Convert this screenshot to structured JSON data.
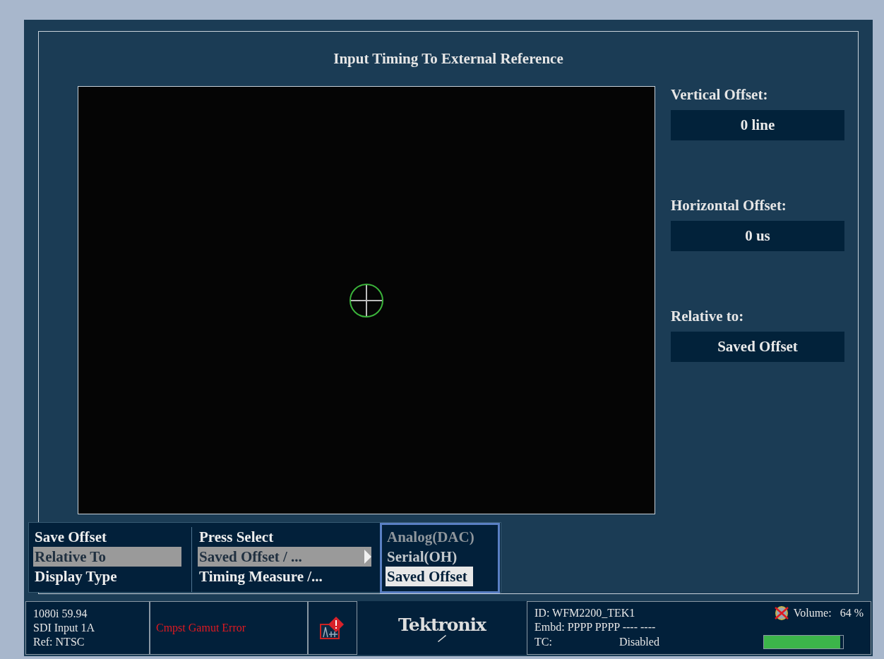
{
  "title": "Input Timing To External Reference",
  "readouts": [
    {
      "label": "Vertical Offset:",
      "value": "0 line"
    },
    {
      "label": "Horizontal Offset:",
      "value": "0 us"
    },
    {
      "label": "Relative to:",
      "value": "Saved Offset"
    }
  ],
  "menu": {
    "labels": [
      {
        "text": "Save Offset",
        "selected": false
      },
      {
        "text": "Relative To",
        "selected": true
      },
      {
        "text": "Display Type",
        "selected": false
      }
    ],
    "values": [
      {
        "text": "Press Select",
        "selected": false,
        "submenu": false
      },
      {
        "text": "Saved Offset / ...",
        "selected": true,
        "submenu": true
      },
      {
        "text": "Timing Measure /...",
        "selected": false,
        "submenu": false
      }
    ],
    "options": [
      {
        "text": "Analog(DAC)",
        "selected": false,
        "disabled": true
      },
      {
        "text": "Serial(OH)",
        "selected": false,
        "disabled": false
      },
      {
        "text": "Saved Offset",
        "selected": true,
        "disabled": false
      }
    ]
  },
  "status": {
    "signal": [
      "1080i 59.94",
      "SDI Input 1A",
      "Ref: NTSC"
    ],
    "alarm": "Cmpst Gamut Error",
    "logo": "Tektronix",
    "id": "ID: WFM2200_TEK1",
    "embd": "Embd: PPPP PPPP ---- ----",
    "tc_label": "TC:",
    "tc_value": "Disabled",
    "volume_label": "Volume:",
    "volume_value": "64 %",
    "muted": true,
    "level": 0.96
  }
}
